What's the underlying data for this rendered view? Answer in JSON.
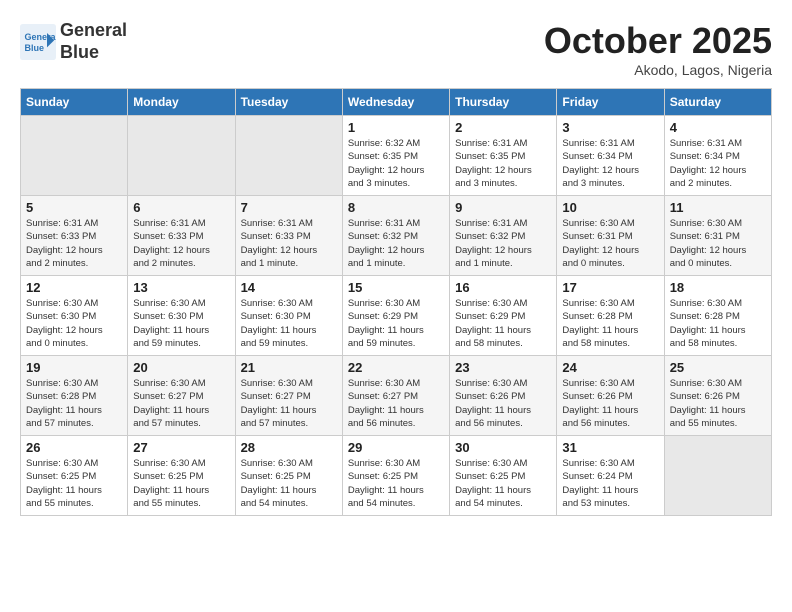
{
  "header": {
    "logo_line1": "General",
    "logo_line2": "Blue",
    "month": "October 2025",
    "location": "Akodo, Lagos, Nigeria"
  },
  "weekdays": [
    "Sunday",
    "Monday",
    "Tuesday",
    "Wednesday",
    "Thursday",
    "Friday",
    "Saturday"
  ],
  "weeks": [
    [
      {
        "day": "",
        "info": ""
      },
      {
        "day": "",
        "info": ""
      },
      {
        "day": "",
        "info": ""
      },
      {
        "day": "1",
        "info": "Sunrise: 6:32 AM\nSunset: 6:35 PM\nDaylight: 12 hours\nand 3 minutes."
      },
      {
        "day": "2",
        "info": "Sunrise: 6:31 AM\nSunset: 6:35 PM\nDaylight: 12 hours\nand 3 minutes."
      },
      {
        "day": "3",
        "info": "Sunrise: 6:31 AM\nSunset: 6:34 PM\nDaylight: 12 hours\nand 3 minutes."
      },
      {
        "day": "4",
        "info": "Sunrise: 6:31 AM\nSunset: 6:34 PM\nDaylight: 12 hours\nand 2 minutes."
      }
    ],
    [
      {
        "day": "5",
        "info": "Sunrise: 6:31 AM\nSunset: 6:33 PM\nDaylight: 12 hours\nand 2 minutes."
      },
      {
        "day": "6",
        "info": "Sunrise: 6:31 AM\nSunset: 6:33 PM\nDaylight: 12 hours\nand 2 minutes."
      },
      {
        "day": "7",
        "info": "Sunrise: 6:31 AM\nSunset: 6:33 PM\nDaylight: 12 hours\nand 1 minute."
      },
      {
        "day": "8",
        "info": "Sunrise: 6:31 AM\nSunset: 6:32 PM\nDaylight: 12 hours\nand 1 minute."
      },
      {
        "day": "9",
        "info": "Sunrise: 6:31 AM\nSunset: 6:32 PM\nDaylight: 12 hours\nand 1 minute."
      },
      {
        "day": "10",
        "info": "Sunrise: 6:30 AM\nSunset: 6:31 PM\nDaylight: 12 hours\nand 0 minutes."
      },
      {
        "day": "11",
        "info": "Sunrise: 6:30 AM\nSunset: 6:31 PM\nDaylight: 12 hours\nand 0 minutes."
      }
    ],
    [
      {
        "day": "12",
        "info": "Sunrise: 6:30 AM\nSunset: 6:30 PM\nDaylight: 12 hours\nand 0 minutes."
      },
      {
        "day": "13",
        "info": "Sunrise: 6:30 AM\nSunset: 6:30 PM\nDaylight: 11 hours\nand 59 minutes."
      },
      {
        "day": "14",
        "info": "Sunrise: 6:30 AM\nSunset: 6:30 PM\nDaylight: 11 hours\nand 59 minutes."
      },
      {
        "day": "15",
        "info": "Sunrise: 6:30 AM\nSunset: 6:29 PM\nDaylight: 11 hours\nand 59 minutes."
      },
      {
        "day": "16",
        "info": "Sunrise: 6:30 AM\nSunset: 6:29 PM\nDaylight: 11 hours\nand 58 minutes."
      },
      {
        "day": "17",
        "info": "Sunrise: 6:30 AM\nSunset: 6:28 PM\nDaylight: 11 hours\nand 58 minutes."
      },
      {
        "day": "18",
        "info": "Sunrise: 6:30 AM\nSunset: 6:28 PM\nDaylight: 11 hours\nand 58 minutes."
      }
    ],
    [
      {
        "day": "19",
        "info": "Sunrise: 6:30 AM\nSunset: 6:28 PM\nDaylight: 11 hours\nand 57 minutes."
      },
      {
        "day": "20",
        "info": "Sunrise: 6:30 AM\nSunset: 6:27 PM\nDaylight: 11 hours\nand 57 minutes."
      },
      {
        "day": "21",
        "info": "Sunrise: 6:30 AM\nSunset: 6:27 PM\nDaylight: 11 hours\nand 57 minutes."
      },
      {
        "day": "22",
        "info": "Sunrise: 6:30 AM\nSunset: 6:27 PM\nDaylight: 11 hours\nand 56 minutes."
      },
      {
        "day": "23",
        "info": "Sunrise: 6:30 AM\nSunset: 6:26 PM\nDaylight: 11 hours\nand 56 minutes."
      },
      {
        "day": "24",
        "info": "Sunrise: 6:30 AM\nSunset: 6:26 PM\nDaylight: 11 hours\nand 56 minutes."
      },
      {
        "day": "25",
        "info": "Sunrise: 6:30 AM\nSunset: 6:26 PM\nDaylight: 11 hours\nand 55 minutes."
      }
    ],
    [
      {
        "day": "26",
        "info": "Sunrise: 6:30 AM\nSunset: 6:25 PM\nDaylight: 11 hours\nand 55 minutes."
      },
      {
        "day": "27",
        "info": "Sunrise: 6:30 AM\nSunset: 6:25 PM\nDaylight: 11 hours\nand 55 minutes."
      },
      {
        "day": "28",
        "info": "Sunrise: 6:30 AM\nSunset: 6:25 PM\nDaylight: 11 hours\nand 54 minutes."
      },
      {
        "day": "29",
        "info": "Sunrise: 6:30 AM\nSunset: 6:25 PM\nDaylight: 11 hours\nand 54 minutes."
      },
      {
        "day": "30",
        "info": "Sunrise: 6:30 AM\nSunset: 6:25 PM\nDaylight: 11 hours\nand 54 minutes."
      },
      {
        "day": "31",
        "info": "Sunrise: 6:30 AM\nSunset: 6:24 PM\nDaylight: 11 hours\nand 53 minutes."
      },
      {
        "day": "",
        "info": ""
      }
    ]
  ]
}
